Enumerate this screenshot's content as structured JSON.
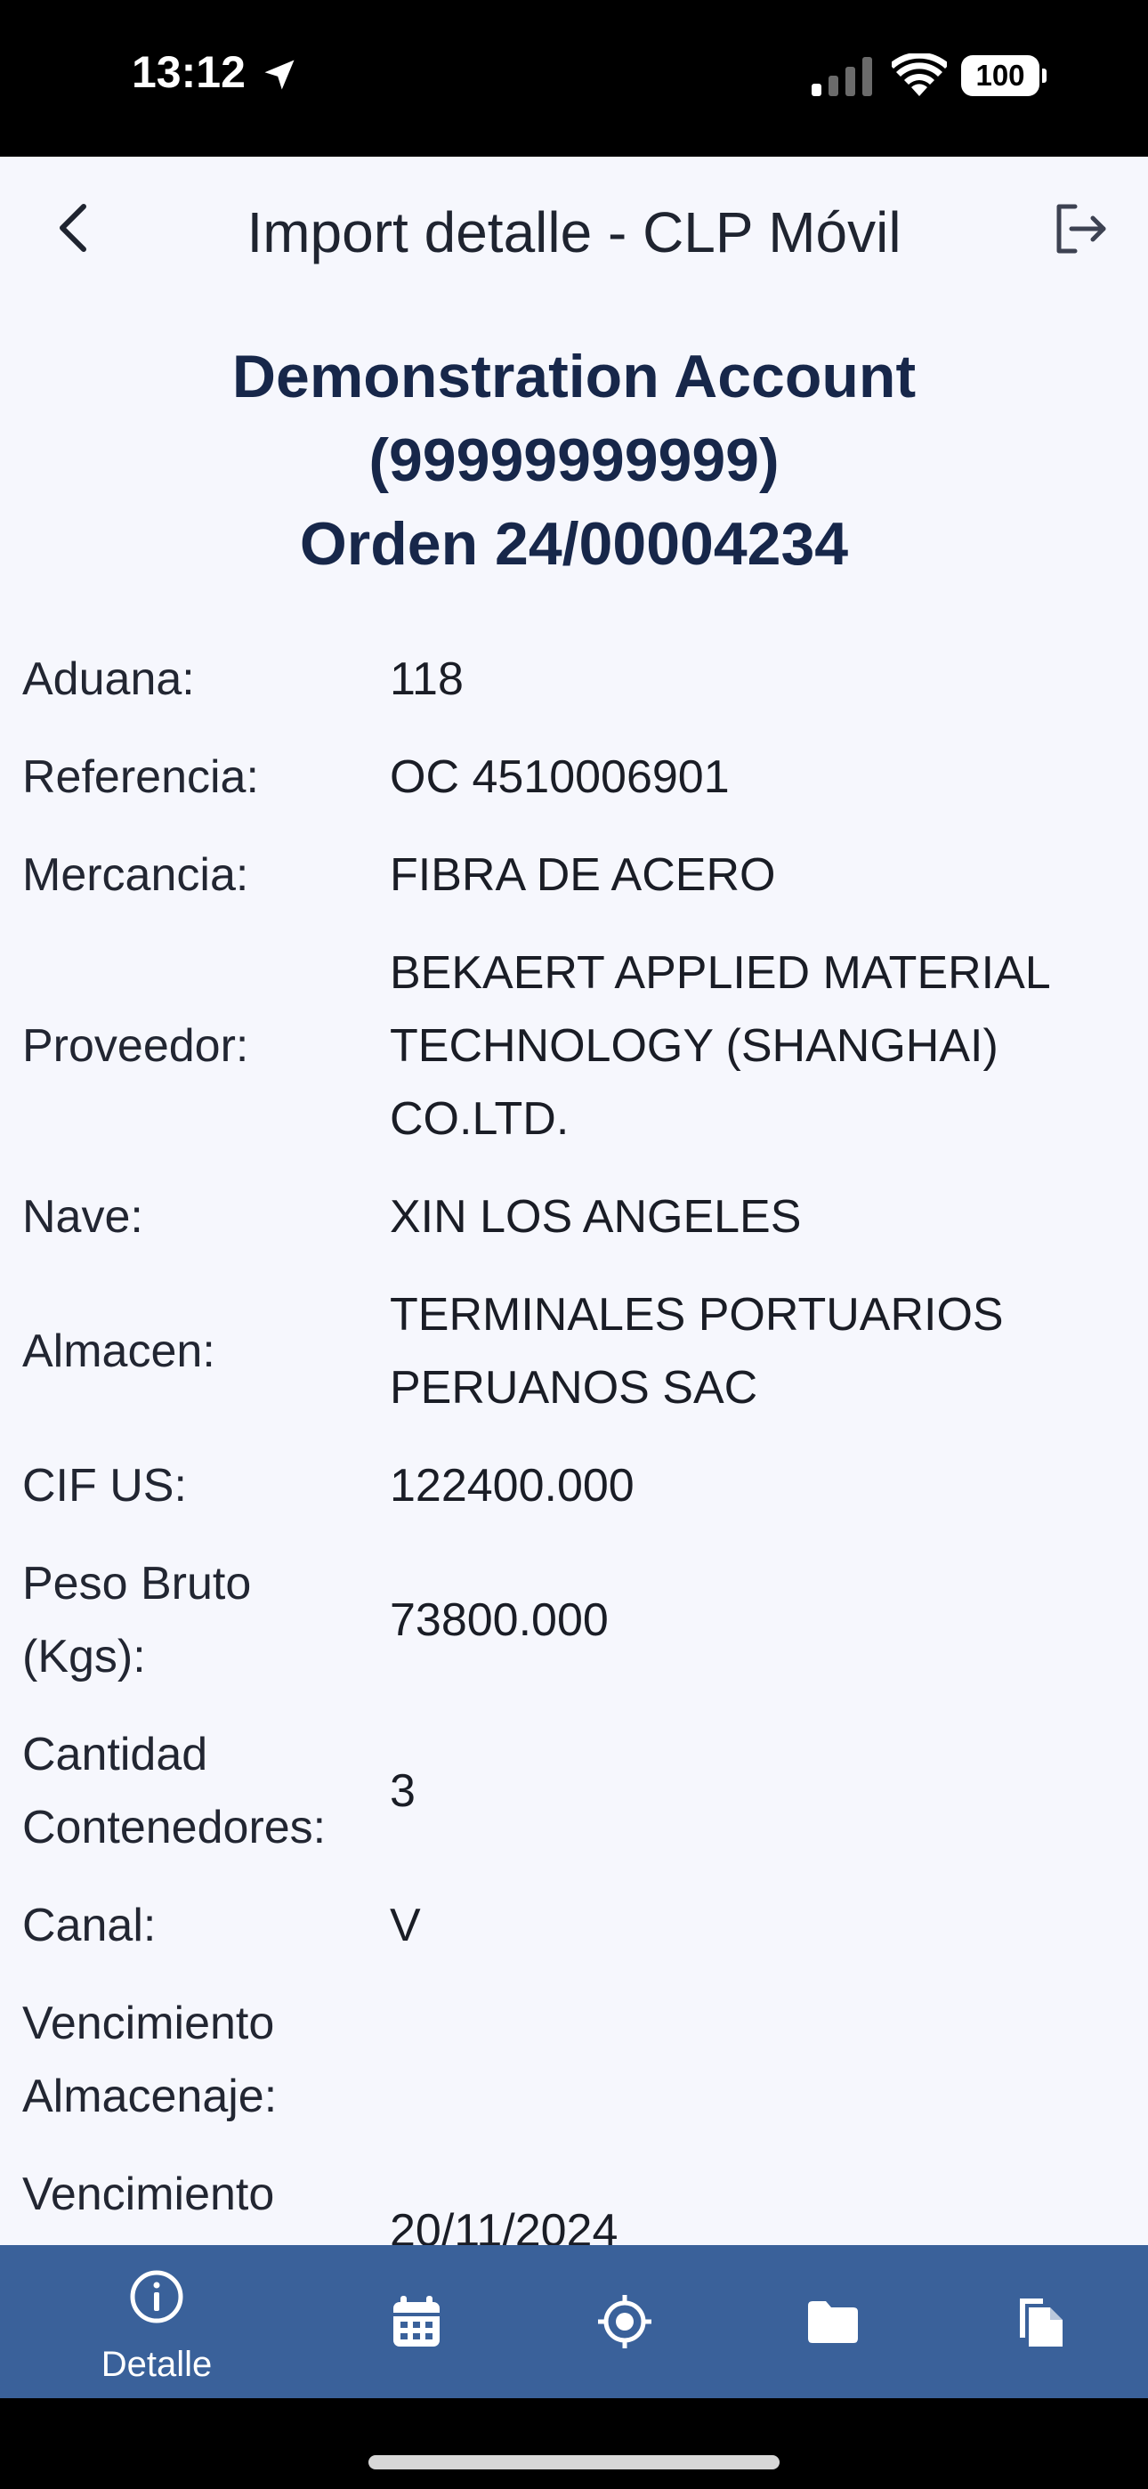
{
  "status_bar": {
    "time": "13:12",
    "battery": "100"
  },
  "header": {
    "title": "Import detalle - CLP Móvil"
  },
  "account": {
    "name": "Demonstration Account",
    "id": "(99999999999)",
    "order": "Orden 24/00004234"
  },
  "details": [
    {
      "label": "Aduana:",
      "value": "118"
    },
    {
      "label": "Referencia:",
      "value": "OC 4510006901"
    },
    {
      "label": "Mercancia:",
      "value": "FIBRA DE ACERO"
    },
    {
      "label": "Proveedor:",
      "value": "BEKAERT APPLIED MATERIAL TECHNOLOGY (SHANGHAI) CO.LTD."
    },
    {
      "label": "Nave:",
      "value": "XIN LOS ANGELES"
    },
    {
      "label": "Almacen:",
      "value": "TERMINALES PORTUARIOS PERUANOS SAC"
    },
    {
      "label": "CIF US:",
      "value": "122400.000"
    },
    {
      "label": "Peso Bruto (Kgs):",
      "value": "73800.000"
    },
    {
      "label": "Cantidad Contenedores:",
      "value": "3"
    },
    {
      "label": "Canal:",
      "value": "V"
    },
    {
      "label": "Vencimiento Almacenaje:",
      "value": ""
    },
    {
      "label": "Vencimiento",
      "value": "20/11/2024"
    }
  ],
  "bottom_nav": {
    "active": "Detalle",
    "items": [
      {
        "icon": "info-icon",
        "label": "Detalle"
      },
      {
        "icon": "calendar-icon",
        "label": ""
      },
      {
        "icon": "location-target-icon",
        "label": ""
      },
      {
        "icon": "folder-icon",
        "label": ""
      },
      {
        "icon": "documents-icon",
        "label": ""
      }
    ]
  },
  "colors": {
    "nav_background": "#3a619a",
    "account_text": "#17274a",
    "app_background": "#f6f7fd"
  }
}
